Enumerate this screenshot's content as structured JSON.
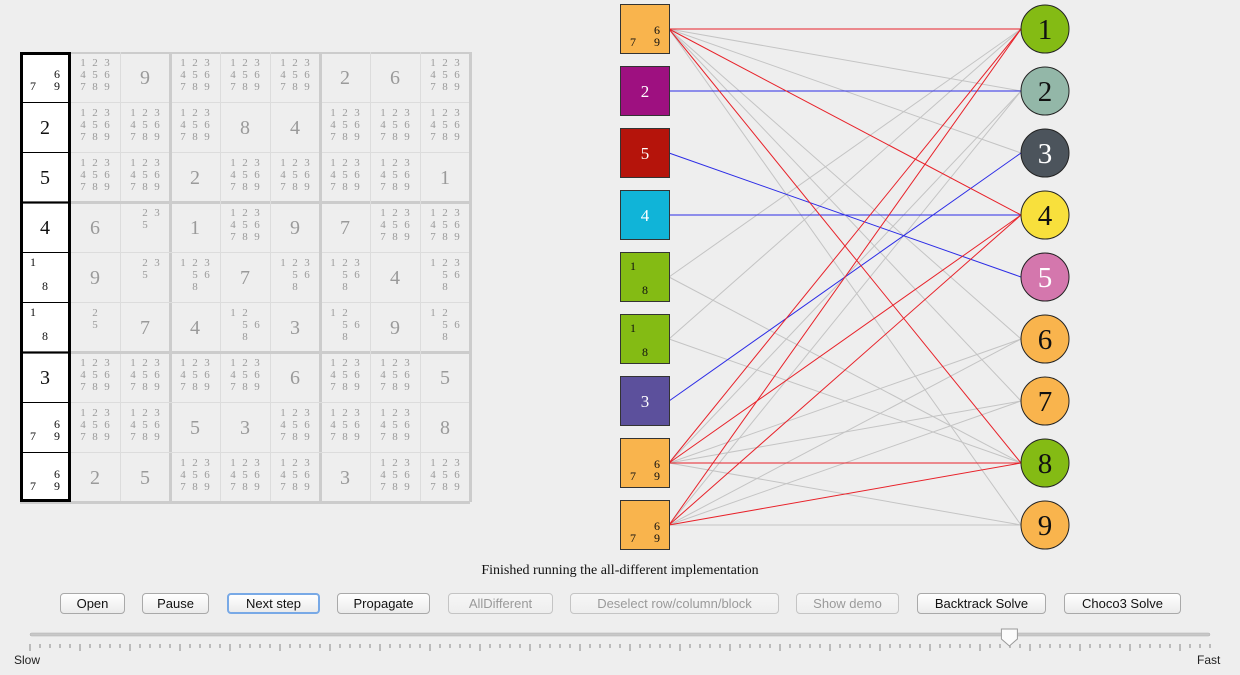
{
  "sudoku": {
    "rows": [
      [
        {
          "c": [
            6,
            7,
            9
          ],
          "sel": true,
          "col": "#f9b44d"
        },
        {
          "c": [
            1,
            2,
            3,
            4,
            5,
            6,
            7,
            8,
            9
          ]
        },
        {
          "v": "9"
        },
        {
          "c": [
            1,
            2,
            3,
            4,
            5,
            6,
            7,
            8,
            9
          ]
        },
        {
          "c": [
            1,
            2,
            3,
            4,
            5,
            6,
            7,
            8,
            9
          ]
        },
        {
          "c": [
            1,
            2,
            3,
            4,
            5,
            6,
            7,
            8,
            9
          ]
        },
        {
          "v": "2"
        },
        {
          "v": "6"
        },
        {
          "c": [
            1,
            2,
            3,
            4,
            5,
            6,
            7,
            8,
            9
          ]
        }
      ],
      [
        {
          "v": "2",
          "sel": true,
          "col": "#9e1080"
        },
        {
          "c": [
            1,
            2,
            3,
            4,
            5,
            6,
            7,
            8,
            9
          ]
        },
        {
          "c": [
            1,
            2,
            3,
            4,
            5,
            6,
            7,
            8,
            9
          ]
        },
        {
          "c": [
            1,
            2,
            3,
            4,
            5,
            6,
            7,
            8,
            9
          ]
        },
        {
          "v": "8"
        },
        {
          "v": "4"
        },
        {
          "c": [
            1,
            2,
            3,
            4,
            5,
            6,
            7,
            8,
            9
          ]
        },
        {
          "c": [
            1,
            2,
            3,
            4,
            5,
            6,
            7,
            8,
            9
          ]
        },
        {
          "c": [
            1,
            2,
            3,
            4,
            5,
            6,
            7,
            8,
            9
          ]
        }
      ],
      [
        {
          "v": "5",
          "sel": true,
          "col": "#b5140b"
        },
        {
          "c": [
            1,
            2,
            3,
            4,
            5,
            6,
            7,
            8,
            9
          ]
        },
        {
          "c": [
            1,
            2,
            3,
            4,
            5,
            6,
            7,
            8,
            9
          ]
        },
        {
          "v": "2"
        },
        {
          "c": [
            1,
            2,
            3,
            4,
            5,
            6,
            7,
            8,
            9
          ]
        },
        {
          "c": [
            1,
            2,
            3,
            4,
            5,
            6,
            7,
            8,
            9
          ]
        },
        {
          "c": [
            1,
            2,
            3,
            4,
            5,
            6,
            7,
            8,
            9
          ]
        },
        {
          "c": [
            1,
            2,
            3,
            4,
            5,
            6,
            7,
            8,
            9
          ]
        },
        {
          "v": "1"
        }
      ],
      [
        {
          "v": "4",
          "sel": true,
          "col": "#10b4d8"
        },
        {
          "v": "6"
        },
        {
          "c": [
            2,
            3,
            5
          ]
        },
        {
          "v": "1"
        },
        {
          "c": [
            1,
            2,
            3,
            4,
            5,
            6,
            7,
            8,
            9
          ]
        },
        {
          "v": "9"
        },
        {
          "v": "7"
        },
        {
          "c": [
            1,
            2,
            3,
            4,
            5,
            6,
            7,
            8,
            9
          ]
        },
        {
          "c": [
            1,
            2,
            3,
            4,
            5,
            6,
            7,
            8,
            9
          ]
        }
      ],
      [
        {
          "c": [
            1,
            8
          ],
          "sel": true,
          "col": "#84bb14"
        },
        {
          "v": "9"
        },
        {
          "c": [
            2,
            3,
            5
          ]
        },
        {
          "c": [
            1,
            2,
            3,
            5,
            6,
            8
          ]
        },
        {
          "v": "7"
        },
        {
          "c": [
            1,
            2,
            3,
            5,
            6,
            8
          ]
        },
        {
          "c": [
            1,
            2,
            3,
            5,
            6,
            8
          ]
        },
        {
          "v": "4"
        },
        {
          "c": [
            1,
            2,
            3,
            5,
            6,
            8
          ]
        }
      ],
      [
        {
          "c": [
            1,
            8
          ],
          "sel": true,
          "col": "#84bb14"
        },
        {
          "c": [
            2,
            5
          ]
        },
        {
          "v": "7"
        },
        {
          "v": "4"
        },
        {
          "c": [
            1,
            2,
            5,
            6,
            8
          ]
        },
        {
          "v": "3"
        },
        {
          "c": [
            1,
            2,
            5,
            6,
            8
          ]
        },
        {
          "v": "9"
        },
        {
          "c": [
            1,
            2,
            5,
            6,
            8
          ]
        }
      ],
      [
        {
          "v": "3",
          "sel": true,
          "col": "#5c509c"
        },
        {
          "c": [
            1,
            2,
            3,
            4,
            5,
            6,
            7,
            8,
            9
          ]
        },
        {
          "c": [
            1,
            2,
            3,
            4,
            5,
            6,
            7,
            8,
            9
          ]
        },
        {
          "c": [
            1,
            2,
            3,
            4,
            5,
            6,
            7,
            8,
            9
          ]
        },
        {
          "c": [
            1,
            2,
            3,
            4,
            5,
            6,
            7,
            8,
            9
          ]
        },
        {
          "v": "6"
        },
        {
          "c": [
            1,
            2,
            3,
            4,
            5,
            6,
            7,
            8,
            9
          ]
        },
        {
          "c": [
            1,
            2,
            3,
            4,
            5,
            6,
            7,
            8,
            9
          ]
        },
        {
          "v": "5"
        }
      ],
      [
        {
          "c": [
            6,
            7,
            9
          ],
          "sel": true,
          "col": "#f9b44d"
        },
        {
          "c": [
            1,
            2,
            3,
            4,
            5,
            6,
            7,
            8,
            9
          ]
        },
        {
          "c": [
            1,
            2,
            3,
            4,
            5,
            6,
            7,
            8,
            9
          ]
        },
        {
          "v": "5"
        },
        {
          "v": "3"
        },
        {
          "c": [
            1,
            2,
            3,
            4,
            5,
            6,
            7,
            8,
            9
          ]
        },
        {
          "c": [
            1,
            2,
            3,
            4,
            5,
            6,
            7,
            8,
            9
          ]
        },
        {
          "c": [
            1,
            2,
            3,
            4,
            5,
            6,
            7,
            8,
            9
          ]
        },
        {
          "v": "8"
        }
      ],
      [
        {
          "c": [
            6,
            7,
            9
          ],
          "sel": true,
          "col": "#f9b44d"
        },
        {
          "v": "2"
        },
        {
          "v": "5"
        },
        {
          "c": [
            1,
            2,
            3,
            4,
            5,
            6,
            7,
            8,
            9
          ]
        },
        {
          "c": [
            1,
            2,
            3,
            4,
            5,
            6,
            7,
            8,
            9
          ]
        },
        {
          "c": [
            1,
            2,
            3,
            4,
            5,
            6,
            7,
            8,
            9
          ]
        },
        {
          "v": "3"
        },
        {
          "c": [
            1,
            2,
            3,
            4,
            5,
            6,
            7,
            8,
            9
          ]
        },
        {
          "c": [
            1,
            2,
            3,
            4,
            5,
            6,
            7,
            8,
            9
          ]
        }
      ]
    ]
  },
  "graph": {
    "left_nodes": [
      {
        "c": [
          6,
          7,
          9
        ],
        "color": "#f9b44d"
      },
      {
        "v": "2",
        "color": "#9e1080"
      },
      {
        "v": "5",
        "color": "#b5140b"
      },
      {
        "v": "4",
        "color": "#10b4d8"
      },
      {
        "c": [
          1,
          8
        ],
        "color": "#84bb14"
      },
      {
        "c": [
          1,
          8
        ],
        "color": "#84bb14"
      },
      {
        "v": "3",
        "color": "#5c509c"
      },
      {
        "c": [
          6,
          7,
          9
        ],
        "color": "#f9b44d"
      },
      {
        "c": [
          6,
          7,
          9
        ],
        "color": "#f9b44d"
      }
    ],
    "right_nodes": [
      {
        "label": "1",
        "color": "#84bb14"
      },
      {
        "label": "2",
        "color": "#93b7a8"
      },
      {
        "label": "3",
        "color": "#4c545c"
      },
      {
        "label": "4",
        "color": "#f8e03c"
      },
      {
        "label": "5",
        "color": "#d477ad"
      },
      {
        "label": "6",
        "color": "#f9b44d"
      },
      {
        "label": "7",
        "color": "#f9b44d"
      },
      {
        "label": "8",
        "color": "#84bb14"
      },
      {
        "label": "9",
        "color": "#f9b44d"
      }
    ],
    "edges": [
      [
        0,
        1,
        "red"
      ],
      [
        0,
        4,
        "red"
      ],
      [
        0,
        8,
        "red"
      ],
      [
        0,
        2,
        "gray"
      ],
      [
        0,
        3,
        "gray"
      ],
      [
        0,
        6,
        "gray"
      ],
      [
        0,
        7,
        "gray"
      ],
      [
        0,
        9,
        "gray"
      ],
      [
        1,
        2,
        "blue"
      ],
      [
        2,
        5,
        "blue"
      ],
      [
        3,
        4,
        "blue"
      ],
      [
        4,
        1,
        "gray"
      ],
      [
        4,
        8,
        "gray"
      ],
      [
        5,
        1,
        "gray"
      ],
      [
        5,
        8,
        "gray"
      ],
      [
        6,
        3,
        "blue"
      ],
      [
        7,
        1,
        "red"
      ],
      [
        7,
        4,
        "red"
      ],
      [
        7,
        8,
        "red"
      ],
      [
        7,
        2,
        "gray"
      ],
      [
        7,
        6,
        "gray"
      ],
      [
        7,
        7,
        "gray"
      ],
      [
        7,
        9,
        "gray"
      ],
      [
        8,
        1,
        "red"
      ],
      [
        8,
        4,
        "red"
      ],
      [
        8,
        8,
        "red"
      ],
      [
        8,
        2,
        "gray"
      ],
      [
        8,
        6,
        "gray"
      ],
      [
        8,
        7,
        "gray"
      ],
      [
        8,
        9,
        "gray"
      ]
    ],
    "edge_colors": {
      "red": "#e8222a",
      "blue": "#2c2ce6",
      "gray": "#c4c4c4"
    }
  },
  "status_text": "Finished running the all-different implementation",
  "buttons": [
    {
      "label": "Open",
      "enabled": true
    },
    {
      "label": "Pause",
      "enabled": true
    },
    {
      "label": "Next step",
      "enabled": true,
      "focused": true
    },
    {
      "label": "Propagate",
      "enabled": true
    },
    {
      "label": "AllDifferent",
      "enabled": false
    },
    {
      "label": "Deselect row/column/block",
      "enabled": false
    },
    {
      "label": "Show demo",
      "enabled": false
    },
    {
      "label": "Backtrack Solve",
      "enabled": true
    },
    {
      "label": "Choco3 Solve",
      "enabled": true
    }
  ],
  "speed_slider": {
    "min_label": "Slow",
    "max_label": "Fast",
    "level": 0.83
  }
}
